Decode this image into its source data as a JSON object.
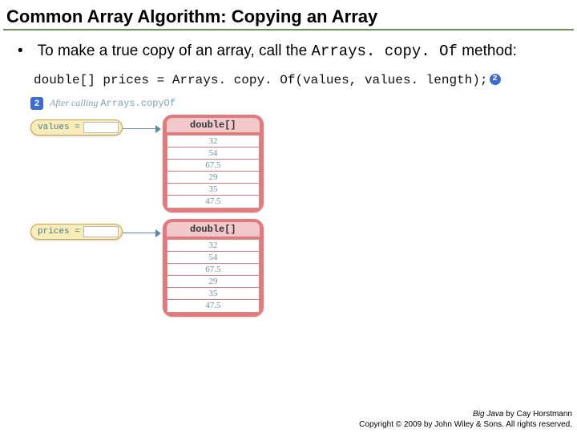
{
  "title": "Common Array Algorithm: Copying an Array",
  "bullet": {
    "text_part1": "To make a true copy of an array, call the ",
    "code_part": "Arrays. copy. Of",
    "text_part2": " method:"
  },
  "code_line": "double[] prices = Arrays. copy. Of(values, values. length);",
  "inline_badge": "2",
  "diagram": {
    "caption_badge": "2",
    "caption_prefix": "After calling ",
    "caption_code": "Arrays.copyOf",
    "var1_label": "values =",
    "var2_label": "prices =",
    "type_label": "double[]"
  },
  "chart_data": {
    "type": "table",
    "arrays": [
      {
        "name": "values",
        "type": "double[]",
        "cells": [
          "32",
          "54",
          "67.5",
          "29",
          "35",
          "47.5"
        ]
      },
      {
        "name": "prices",
        "type": "double[]",
        "cells": [
          "32",
          "54",
          "67.5",
          "29",
          "35",
          "47.5"
        ]
      }
    ]
  },
  "footer": {
    "book": "Big Java",
    "by": " by Cay Horstmann",
    "copyright": "Copyright © 2009 by John Wiley & Sons.  All rights reserved."
  }
}
